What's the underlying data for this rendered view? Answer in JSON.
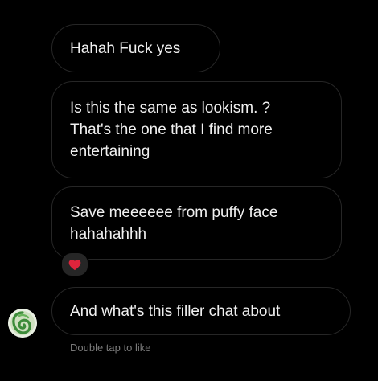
{
  "messages": [
    {
      "text": "Hahah Fuck yes"
    },
    {
      "text": "Is this the same as lookism. ?\nThat's the one that I find more\nentertaining"
    },
    {
      "text": "Save meeeeee from puffy face\nhahahahhh",
      "reaction": "red-heart-icon"
    },
    {
      "text": "And what's this filler chat about"
    }
  ],
  "reaction_color": "#e0243c",
  "avatar_icon": "green-swirl-avatar",
  "hint": "Double tap to like"
}
